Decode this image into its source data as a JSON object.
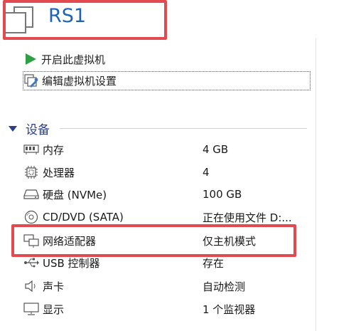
{
  "vm": {
    "name": "RS1"
  },
  "actions": [
    {
      "label": "开启此虚拟机",
      "icon": "play-icon"
    },
    {
      "label": "编辑虚拟机设置",
      "icon": "edit-settings-icon"
    }
  ],
  "devices_section": {
    "title": "设备",
    "toggle_icon": "collapse-triangle-icon"
  },
  "devices": [
    {
      "name": "内存",
      "value": "4 GB",
      "icon": "memory-icon"
    },
    {
      "name": "处理器",
      "value": "4",
      "icon": "processor-icon"
    },
    {
      "name": "硬盘 (NVMe)",
      "value": "100 GB",
      "icon": "hard-disk-icon"
    },
    {
      "name": "CD/DVD (SATA)",
      "value": "正在使用文件 D:...",
      "icon": "cd-dvd-icon"
    },
    {
      "name": "网络适配器",
      "value": "仅主机模式",
      "icon": "network-adapter-icon"
    },
    {
      "name": "USB 控制器",
      "value": "存在",
      "icon": "usb-icon"
    },
    {
      "name": "声卡",
      "value": "自动检测",
      "icon": "sound-card-icon"
    },
    {
      "name": "显示",
      "value": "1 个监视器",
      "icon": "display-icon"
    }
  ],
  "colors": {
    "title": "#1f64b4",
    "section": "#2b3f8c",
    "highlight": "#e34a4f",
    "play": "#2ea043"
  }
}
